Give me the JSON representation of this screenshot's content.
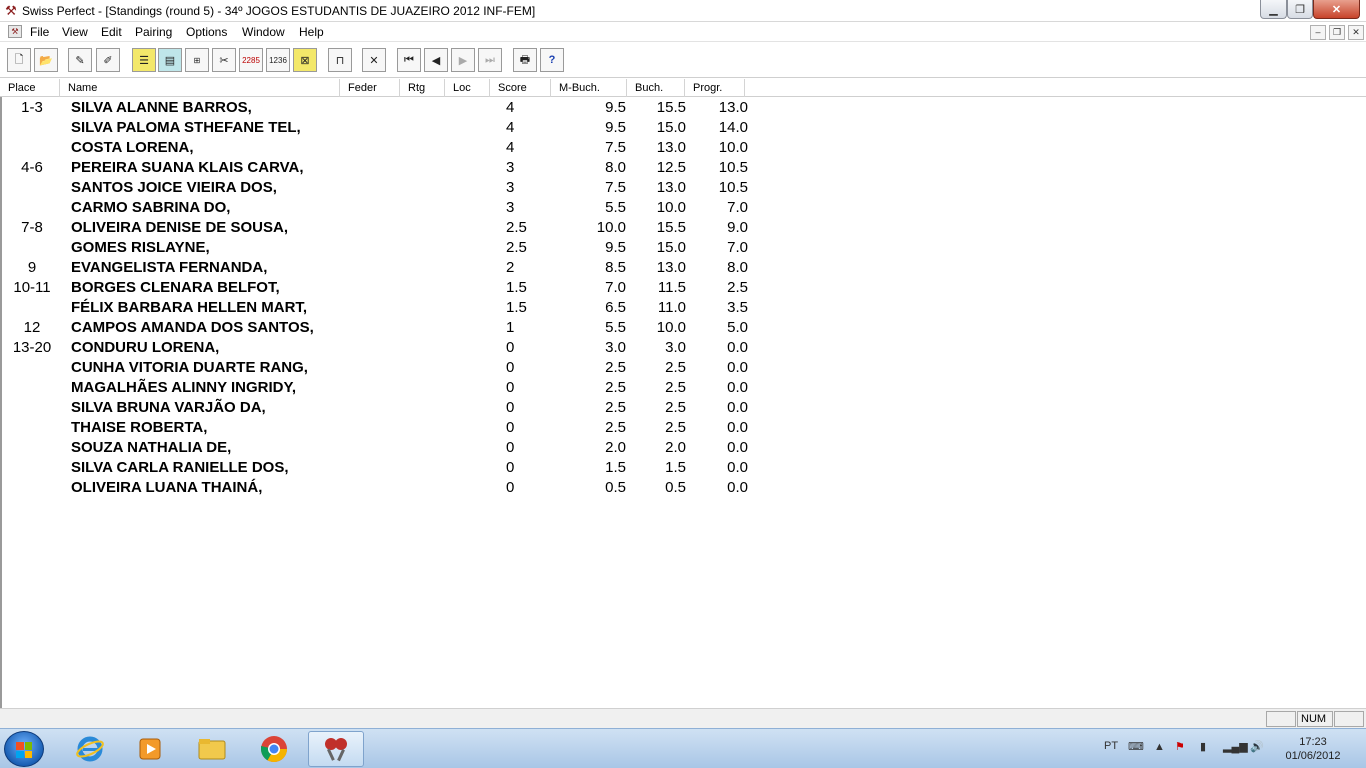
{
  "window": {
    "title": "Swiss Perfect - [Standings  (round 5) - 34º JOGOS ESTUDANTIS DE JUAZEIRO 2012 INF-FEM]"
  },
  "menu": [
    "File",
    "View",
    "Edit",
    "Pairing",
    "Options",
    "Window",
    "Help"
  ],
  "toolbar_icons": [
    "new-icon",
    "open-icon",
    "edit-player-icon",
    "delete-player-icon",
    "player-list-icon",
    "standings-icon",
    "crosstable-icon",
    "results-icon",
    "ratings-icon",
    "numbers-icon",
    "report-icon",
    "table-icon",
    "cancel-icon",
    "first-round-icon",
    "previous-round-icon",
    "next-round-icon",
    "last-round-icon",
    "print-icon",
    "help-icon"
  ],
  "toolbar_labels": {
    "ratings": "2285",
    "numbers": "1236"
  },
  "columns": [
    "Place",
    "Name",
    "Feder",
    "Rtg",
    "Loc",
    "Score",
    "M-Buch.",
    "Buch.",
    "Progr."
  ],
  "rows": [
    {
      "place": "1-3",
      "name": "SILVA ALANNE BARROS,",
      "score": "4",
      "mbuch": "9.5",
      "buch": "15.5",
      "prog": "13.0"
    },
    {
      "place": "",
      "name": "SILVA PALOMA STHEFANE TEL,",
      "score": "4",
      "mbuch": "9.5",
      "buch": "15.0",
      "prog": "14.0"
    },
    {
      "place": "",
      "name": "COSTA LORENA,",
      "score": "4",
      "mbuch": "7.5",
      "buch": "13.0",
      "prog": "10.0"
    },
    {
      "place": "4-6",
      "name": "PEREIRA SUANA KLAIS CARVA,",
      "score": "3",
      "mbuch": "8.0",
      "buch": "12.5",
      "prog": "10.5"
    },
    {
      "place": "",
      "name": "SANTOS JOICE VIEIRA DOS,",
      "score": "3",
      "mbuch": "7.5",
      "buch": "13.0",
      "prog": "10.5"
    },
    {
      "place": "",
      "name": "CARMO SABRINA DO,",
      "score": "3",
      "mbuch": "5.5",
      "buch": "10.0",
      "prog": "7.0"
    },
    {
      "place": "7-8",
      "name": "OLIVEIRA DENISE DE SOUSA,",
      "score": "2.5",
      "mbuch": "10.0",
      "buch": "15.5",
      "prog": "9.0"
    },
    {
      "place": "",
      "name": "GOMES RISLAYNE,",
      "score": "2.5",
      "mbuch": "9.5",
      "buch": "15.0",
      "prog": "7.0"
    },
    {
      "place": "9",
      "name": "EVANGELISTA FERNANDA,",
      "score": "2",
      "mbuch": "8.5",
      "buch": "13.0",
      "prog": "8.0"
    },
    {
      "place": "10-11",
      "name": "BORGES CLENARA BELFOT,",
      "score": "1.5",
      "mbuch": "7.0",
      "buch": "11.5",
      "prog": "2.5"
    },
    {
      "place": "",
      "name": "FÉLIX BARBARA HELLEN MART,",
      "score": "1.5",
      "mbuch": "6.5",
      "buch": "11.0",
      "prog": "3.5"
    },
    {
      "place": "12",
      "name": "CAMPOS AMANDA DOS SANTOS,",
      "score": "1",
      "mbuch": "5.5",
      "buch": "10.0",
      "prog": "5.0"
    },
    {
      "place": "13-20",
      "name": "CONDURU LORENA,",
      "score": "0",
      "mbuch": "3.0",
      "buch": "3.0",
      "prog": "0.0"
    },
    {
      "place": "",
      "name": "CUNHA VITORIA DUARTE RANG,",
      "score": "0",
      "mbuch": "2.5",
      "buch": "2.5",
      "prog": "0.0"
    },
    {
      "place": "",
      "name": "MAGALHÃES ALINNY INGRIDY,",
      "score": "0",
      "mbuch": "2.5",
      "buch": "2.5",
      "prog": "0.0"
    },
    {
      "place": "",
      "name": "SILVA BRUNA VARJÃO DA,",
      "score": "0",
      "mbuch": "2.5",
      "buch": "2.5",
      "prog": "0.0"
    },
    {
      "place": "",
      "name": "THAISE ROBERTA,",
      "score": "0",
      "mbuch": "2.5",
      "buch": "2.5",
      "prog": "0.0"
    },
    {
      "place": "",
      "name": "SOUZA NATHALIA DE,",
      "score": "0",
      "mbuch": "2.0",
      "buch": "2.0",
      "prog": "0.0"
    },
    {
      "place": "",
      "name": "SILVA CARLA RANIELLE DOS,",
      "score": "0",
      "mbuch": "1.5",
      "buch": "1.5",
      "prog": "0.0"
    },
    {
      "place": "",
      "name": "OLIVEIRA LUANA THAINÁ,",
      "score": "0",
      "mbuch": "0.5",
      "buch": "0.5",
      "prog": "0.0"
    }
  ],
  "status": {
    "num": "NUM"
  },
  "taskbar": {
    "apps": [
      "start-button",
      "internet-explorer-icon",
      "media-player-icon",
      "file-explorer-icon",
      "chrome-icon",
      "swiss-perfect-icon"
    ],
    "language": "PT",
    "time": "17:23",
    "date": "01/06/2012"
  },
  "colors": {
    "close_button": "#c7432a",
    "taskbar": "#a9c6e6",
    "toolbar_yellow": "#f3e86a"
  }
}
